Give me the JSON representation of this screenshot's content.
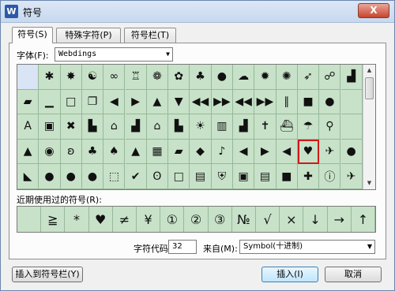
{
  "window": {
    "title": "符号",
    "close_label": "X"
  },
  "tabs": [
    {
      "label": "符号(S)",
      "active": true
    },
    {
      "label": "特殊字符(P)",
      "active": false
    },
    {
      "label": "符号栏(T)",
      "active": false
    }
  ],
  "font": {
    "label": "字体(F):",
    "value": "Webdings"
  },
  "symbols": [
    {
      "icon": "blank",
      "glyph": ""
    },
    {
      "icon": "spider-icon",
      "glyph": "✱"
    },
    {
      "icon": "web-icon",
      "glyph": "✸"
    },
    {
      "icon": "cat-icon",
      "glyph": "☯"
    },
    {
      "icon": "sunglasses-icon",
      "glyph": "∞"
    },
    {
      "icon": "trophy-icon",
      "glyph": "♖"
    },
    {
      "icon": "medal-icon",
      "glyph": "❁"
    },
    {
      "icon": "ribbon-icon",
      "glyph": "✿"
    },
    {
      "icon": "hat-icon",
      "glyph": "♣"
    },
    {
      "icon": "speech-bubble-icon",
      "glyph": "●"
    },
    {
      "icon": "thought-bubble-icon",
      "glyph": "☁"
    },
    {
      "icon": "explosion-icon",
      "glyph": "✹"
    },
    {
      "icon": "bang-icon",
      "glyph": "✺"
    },
    {
      "icon": "carrot-icon",
      "glyph": "➶"
    },
    {
      "icon": "ribbon-aware-icon",
      "glyph": "☍"
    },
    {
      "icon": "checker-icon",
      "glyph": "▟"
    },
    {
      "icon": "parallelogram-icon",
      "glyph": "▰"
    },
    {
      "icon": "minimize-icon",
      "glyph": "▁"
    },
    {
      "icon": "maximize-icon",
      "glyph": "□"
    },
    {
      "icon": "restore-icon",
      "glyph": "❐"
    },
    {
      "icon": "triangle-left-icon",
      "glyph": "◀"
    },
    {
      "icon": "triangle-right-icon",
      "glyph": "▶"
    },
    {
      "icon": "triangle-up-icon",
      "glyph": "▲"
    },
    {
      "icon": "triangle-down-icon",
      "glyph": "▼"
    },
    {
      "icon": "rewind-icon",
      "glyph": "◀◀"
    },
    {
      "icon": "forward-icon",
      "glyph": "▶▶"
    },
    {
      "icon": "prev-icon",
      "glyph": "◀◀"
    },
    {
      "icon": "next-icon",
      "glyph": "▶▶"
    },
    {
      "icon": "pause-icon",
      "glyph": "∥"
    },
    {
      "icon": "stop-icon",
      "glyph": "■"
    },
    {
      "icon": "record-icon",
      "glyph": "●"
    },
    {
      "icon": "blank",
      "glyph": ""
    },
    {
      "icon": "text-size-icon",
      "glyph": "A"
    },
    {
      "icon": "box-icon",
      "glyph": "▣"
    },
    {
      "icon": "tools-icon",
      "glyph": "✖"
    },
    {
      "icon": "building-icon",
      "glyph": "▙"
    },
    {
      "icon": "house-icon",
      "glyph": "⌂"
    },
    {
      "icon": "city-icon",
      "glyph": "▟"
    },
    {
      "icon": "houses-icon",
      "glyph": "⌂"
    },
    {
      "icon": "factory-icon",
      "glyph": "▙"
    },
    {
      "icon": "desert-icon",
      "glyph": "☀"
    },
    {
      "icon": "bank-icon",
      "glyph": "▥"
    },
    {
      "icon": "city-night-icon",
      "glyph": "▟"
    },
    {
      "icon": "church-icon",
      "glyph": "✝"
    },
    {
      "icon": "ship-icon",
      "glyph": "⛴"
    },
    {
      "icon": "island-icon",
      "glyph": "☂"
    },
    {
      "icon": "search-icon",
      "glyph": "⚲"
    },
    {
      "icon": "blank",
      "glyph": ""
    },
    {
      "icon": "mountain-icon",
      "glyph": "▲"
    },
    {
      "icon": "eye-icon",
      "glyph": "◉"
    },
    {
      "icon": "ear-icon",
      "glyph": "ʚ"
    },
    {
      "icon": "tree-icon",
      "glyph": "♣"
    },
    {
      "icon": "forest-icon",
      "glyph": "♠"
    },
    {
      "icon": "road-icon",
      "glyph": "▲"
    },
    {
      "icon": "stadium-icon",
      "glyph": "▦"
    },
    {
      "icon": "boat-icon",
      "glyph": "▰"
    },
    {
      "icon": "sports-icon",
      "glyph": "◆"
    },
    {
      "icon": "loudspeaker-icon",
      "glyph": "♪"
    },
    {
      "icon": "megaphone-icon",
      "glyph": "◀"
    },
    {
      "icon": "speaker-on-icon",
      "glyph": "▶"
    },
    {
      "icon": "speaker-off-icon",
      "glyph": "◀"
    },
    {
      "icon": "heart-icon",
      "glyph": "♥"
    },
    {
      "icon": "running-icon",
      "glyph": "✈"
    },
    {
      "icon": "speech-icon",
      "glyph": "●"
    },
    {
      "icon": "slash-icon",
      "glyph": "◣"
    },
    {
      "icon": "chat-icon",
      "glyph": "●"
    },
    {
      "icon": "chat-multi-icon",
      "glyph": "●"
    },
    {
      "icon": "people-icon",
      "glyph": "●"
    },
    {
      "icon": "frame-icon",
      "glyph": "⬚"
    },
    {
      "icon": "check-icon",
      "glyph": "✔"
    },
    {
      "icon": "bicycle-icon",
      "glyph": "ʘ"
    },
    {
      "icon": "empty-square-icon",
      "glyph": "□"
    },
    {
      "icon": "document-icon",
      "glyph": "▤"
    },
    {
      "icon": "shield-icon",
      "glyph": "⛨"
    },
    {
      "icon": "gift-icon",
      "glyph": "▣"
    },
    {
      "icon": "bag-icon",
      "glyph": "▤"
    },
    {
      "icon": "filled-square-icon",
      "glyph": "■"
    },
    {
      "icon": "ambulance-icon",
      "glyph": "✚"
    },
    {
      "icon": "info-icon",
      "glyph": "ⓘ"
    },
    {
      "icon": "plane-icon",
      "glyph": "✈"
    }
  ],
  "recent": {
    "label": "近期使用过的符号(R):",
    "items": [
      "",
      "≧",
      "*",
      "♥",
      "≠",
      "¥",
      "①",
      "②",
      "③",
      "№",
      "√",
      "×",
      "↓",
      "→",
      "↑"
    ]
  },
  "char_code": {
    "label": "字符代码(C):",
    "value": "32"
  },
  "from": {
    "label": "来自(M):",
    "value": "Symbol(十进制)"
  },
  "buttons": {
    "insert_to_bar": "插入到符号栏(Y)",
    "insert": "插入(I)",
    "cancel": "取消"
  },
  "colors": {
    "grid_bg": "#c7e2c8",
    "selected_outline": "#d01818",
    "title_bar": "#c7d8ee"
  }
}
